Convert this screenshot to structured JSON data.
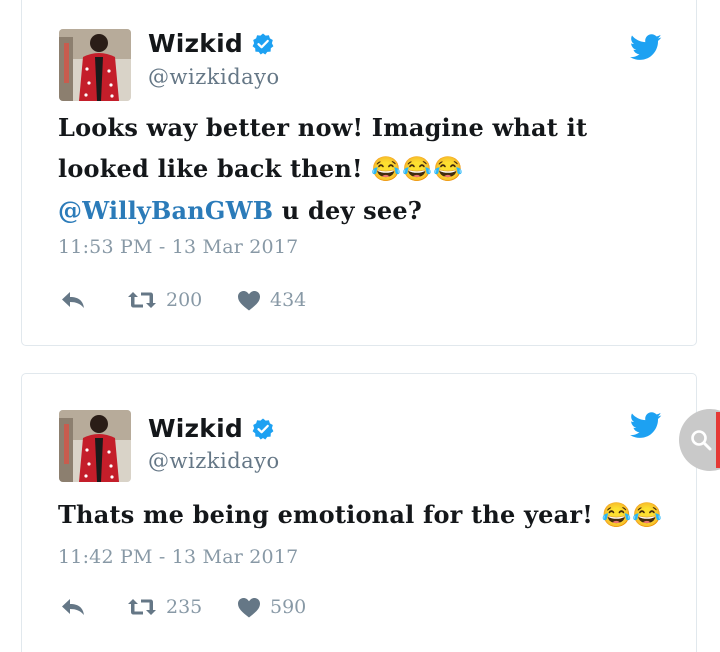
{
  "tweets": [
    {
      "display_name": "Wizkid",
      "handle": "@wizkidayo",
      "text_before": "Looks way better now! Imagine what it looked like back then! ",
      "emojis": "😂😂😂",
      "mention": "@WillyBanGWB",
      "text_after": " u dey see?",
      "timestamp": "11:53 PM - 13 Mar 2017",
      "retweets": "200",
      "likes": "434"
    },
    {
      "display_name": "Wizkid",
      "handle": "@wizkidayo",
      "text_before": "Thats me being emotional for the year! ",
      "emojis": "😂😂",
      "timestamp": "11:42 PM - 13 Mar 2017",
      "retweets": "235",
      "likes": "590"
    }
  ],
  "icons": {
    "brand": "twitter-bird-icon",
    "verified": "verified-badge-icon",
    "reply": "reply-icon",
    "retweet": "retweet-icon",
    "like": "heart-icon",
    "search": "search-icon"
  },
  "colors": {
    "twitter_blue": "#1da1f2",
    "mention": "#2b7bb9",
    "muted": "#8899a6",
    "handle": "#657786",
    "fab_accent": "#e53935"
  }
}
